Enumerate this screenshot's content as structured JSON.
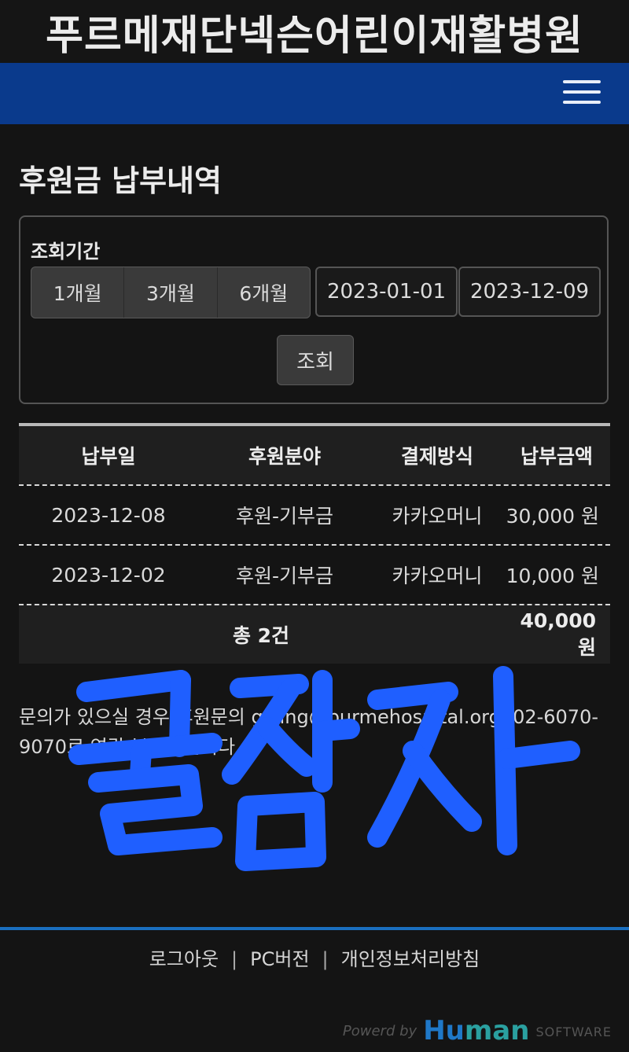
{
  "site": {
    "title": "푸르메재단넥슨어린이재활병원"
  },
  "nav": {
    "menu_icon": "hamburger-menu-icon"
  },
  "page": {
    "title": "후원금 납부내역"
  },
  "filter": {
    "label": "조회기간",
    "periods": [
      "1개월",
      "3개월",
      "6개월"
    ],
    "start_date": "2023-01-01",
    "end_date": "2023-12-09",
    "search_label": "조회"
  },
  "table": {
    "headers": [
      "납부일",
      "후원분야",
      "결제방식",
      "납부금액"
    ],
    "rows": [
      {
        "date": "2023-12-08",
        "field": "후원-기부금",
        "method": "카카오머니",
        "amount": "30,000 원"
      },
      {
        "date": "2023-12-02",
        "field": "후원-기부금",
        "method": "카카오머니",
        "amount": "10,000 원"
      }
    ],
    "total_label": "총 2건",
    "total_amount": "40,000원"
  },
  "inquiry": {
    "text": "문의가 있으실 경우 후원문의 giving@purmehospital.org, 02-6070-9070로 연락 부탁드립니다."
  },
  "signature": {
    "text": "꿀잠자",
    "color": "#1f5fff"
  },
  "footer": {
    "links": [
      "로그아웃",
      "PC버전",
      "개인정보처리방침"
    ],
    "separator": "|",
    "powered_by": "Powerd by",
    "brand_a": "Hu",
    "brand_b": "man",
    "brand_suffix": "SOFTWARE"
  },
  "colors": {
    "navbar": "#0a3a8c",
    "footer_line": "#1a6fbf",
    "background": "#141414"
  }
}
